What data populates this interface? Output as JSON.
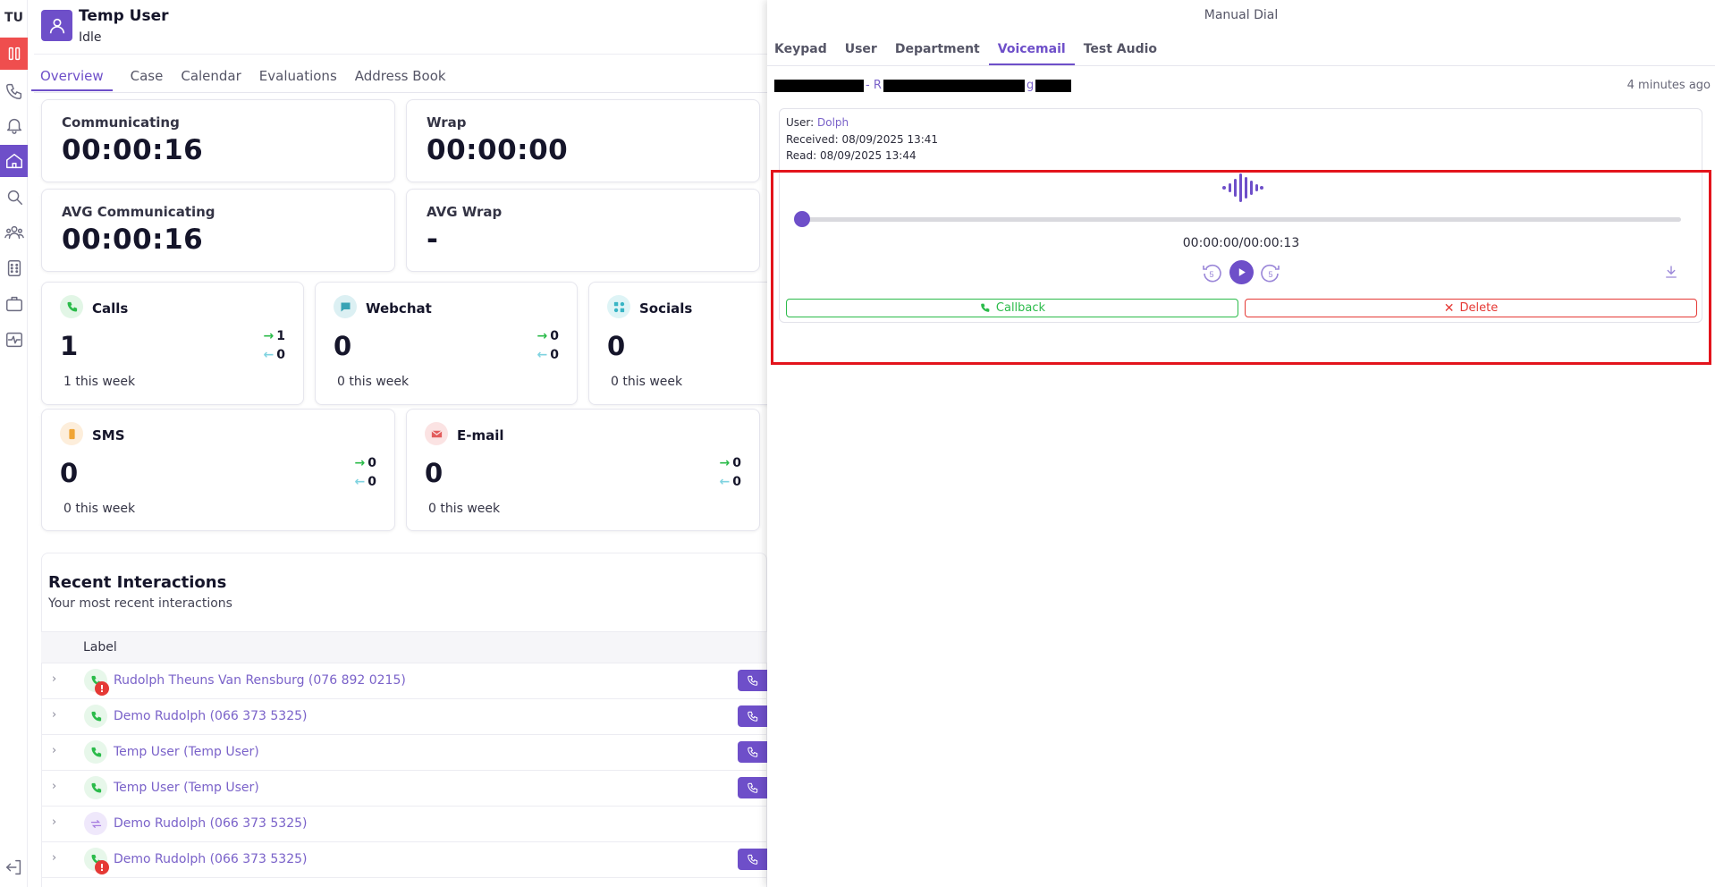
{
  "rail": {
    "initials": "TU"
  },
  "header": {
    "name": "Temp User",
    "status": "Idle"
  },
  "tabs": [
    "Overview",
    "Case",
    "Calendar",
    "Evaluations",
    "Address Book"
  ],
  "stats": [
    {
      "label": "Communicating",
      "value": "00:00:16"
    },
    {
      "label": "Wrap",
      "value": "00:00:00"
    },
    {
      "label": "AVG Communicating",
      "value": "00:00:16"
    },
    {
      "label": "AVG Wrap",
      "value": "-"
    }
  ],
  "channels": [
    {
      "name": "Calls",
      "count": "1",
      "outbound": "1",
      "inbound": "0",
      "week": "1 this week",
      "icon": "phone-icon",
      "color": "#2bbb4a",
      "bg": "#e2f6e6"
    },
    {
      "name": "Webchat",
      "count": "0",
      "outbound": "0",
      "inbound": "0",
      "week": "0 this week",
      "icon": "chat-icon",
      "color": "#38a3b5",
      "bg": "#dcf0f3"
    },
    {
      "name": "Socials",
      "count": "0",
      "outbound": "",
      "inbound": "",
      "week": "0 this week",
      "icon": "socials-icon",
      "color": "#38b5c5",
      "bg": "#def4f6"
    },
    {
      "name": "SMS",
      "count": "0",
      "outbound": "0",
      "inbound": "0",
      "week": "0 this week",
      "icon": "sms-icon",
      "color": "#f0a535",
      "bg": "#fdeedb"
    },
    {
      "name": "E-mail",
      "count": "0",
      "outbound": "0",
      "inbound": "0",
      "week": "0 this week",
      "icon": "mail-icon",
      "color": "#e25c5c",
      "bg": "#fbe3e3"
    }
  ],
  "recent": {
    "title": "Recent Interactions",
    "subtitle": "Your most recent interactions",
    "column_label": "Label",
    "rows": [
      {
        "label": "Rudolph Theuns Van Rensburg (076 892 0215)",
        "type": "call",
        "alert": true,
        "callable": true
      },
      {
        "label": "Demo Rudolph (066 373 5325)",
        "type": "call",
        "alert": false,
        "callable": true
      },
      {
        "label": "Temp User (Temp User)",
        "type": "call",
        "alert": false,
        "callable": true
      },
      {
        "label": "Temp User (Temp User)",
        "type": "call",
        "alert": false,
        "callable": true
      },
      {
        "label": "Demo Rudolph (066 373 5325)",
        "type": "transfer",
        "alert": false,
        "callable": false
      },
      {
        "label": "Demo Rudolph (066 373 5325)",
        "type": "call",
        "alert": true,
        "callable": true
      }
    ]
  },
  "panel": {
    "title": "Manual Dial",
    "tabs": [
      "Keypad",
      "User",
      "Department",
      "Voicemail",
      "Test Audio"
    ],
    "active_tab": "Voicemail",
    "voicemail": {
      "header_fragment_1": "- R",
      "header_fragment_2": "g",
      "age": "4 minutes ago",
      "user_label": "User:",
      "user_value": "Dolph",
      "received_label": "Received:",
      "received_value": "08/09/2025 13:41",
      "read_label": "Read:",
      "read_value": "08/09/2025 13:44",
      "time_display": "00:00:00/00:00:13",
      "progress": 0,
      "callback_label": "Callback",
      "delete_label": "Delete"
    }
  },
  "colors": {
    "accent": "#6e4fc9",
    "danger": "#e53935",
    "success": "#2bbb4a",
    "highlight": "#e3141c"
  }
}
